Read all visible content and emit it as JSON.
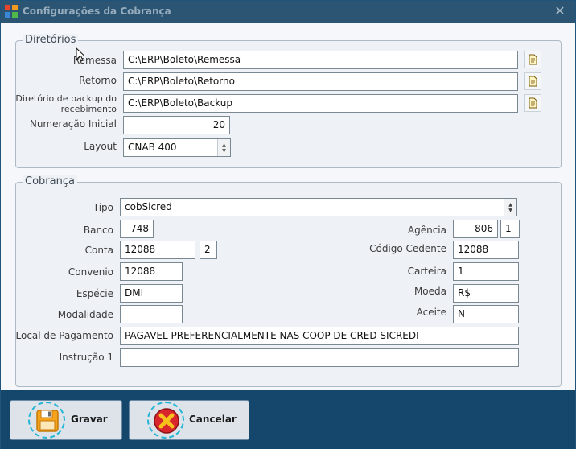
{
  "window": {
    "title": "Configurações da Cobrança",
    "close_glyph": "✕"
  },
  "diretorios": {
    "title": "Diretórios",
    "remessa_label": "Remessa",
    "remessa_value": "C:\\ERP\\Boleto\\Remessa",
    "retorno_label": "Retorno",
    "retorno_value": "C:\\ERP\\Boleto\\Retorno",
    "backup_label_line1": "Diretório de backup do",
    "backup_label_line2": "recebimento",
    "backup_value": "C:\\ERP\\Boleto\\Backup",
    "numeracao_label": "Numeração Inicial",
    "numeracao_value": "20",
    "layout_label": "Layout",
    "layout_value": "CNAB 400",
    "folder_icon": "folder-browse-icon"
  },
  "cobranca": {
    "title": "Cobrança",
    "tipo_label": "Tipo",
    "tipo_value": "cobSicred",
    "banco_label": "Banco",
    "banco_value": "748",
    "agencia_label": "Agência",
    "agencia_value": "806",
    "agencia_digito": "1",
    "conta_label": "Conta",
    "conta_value": "12088",
    "conta_digito": "2",
    "cedente_label": "Código Cedente",
    "cedente_value": "12088",
    "convenio_label": "Convenio",
    "convenio_value": "12088",
    "carteira_label": "Carteira",
    "carteira_value": "1",
    "especie_label": "Espécie",
    "especie_value": "DMI",
    "moeda_label": "Moeda",
    "moeda_value": "R$",
    "modalidade_label": "Modalidade",
    "modalidade_value": "",
    "aceite_label": "Aceite",
    "aceite_value": "N",
    "local_label": "Local de Pagamento",
    "local_value": "PAGAVEL PREFERENCIALMENTE NAS COOP DE CRED SICREDI",
    "instrucao_label": "Instrução 1",
    "instrucao_value": ""
  },
  "footer": {
    "gravar_label": "Gravar",
    "cancelar_label": "Cancelar",
    "gravar_icon": "floppy-disk-icon",
    "cancelar_icon": "cancel-x-icon"
  },
  "colors": {
    "titlebar": "#2b5573",
    "footer": "#15466b",
    "accent_ring": "#24b6d4",
    "cancel_red": "#d9252c"
  }
}
